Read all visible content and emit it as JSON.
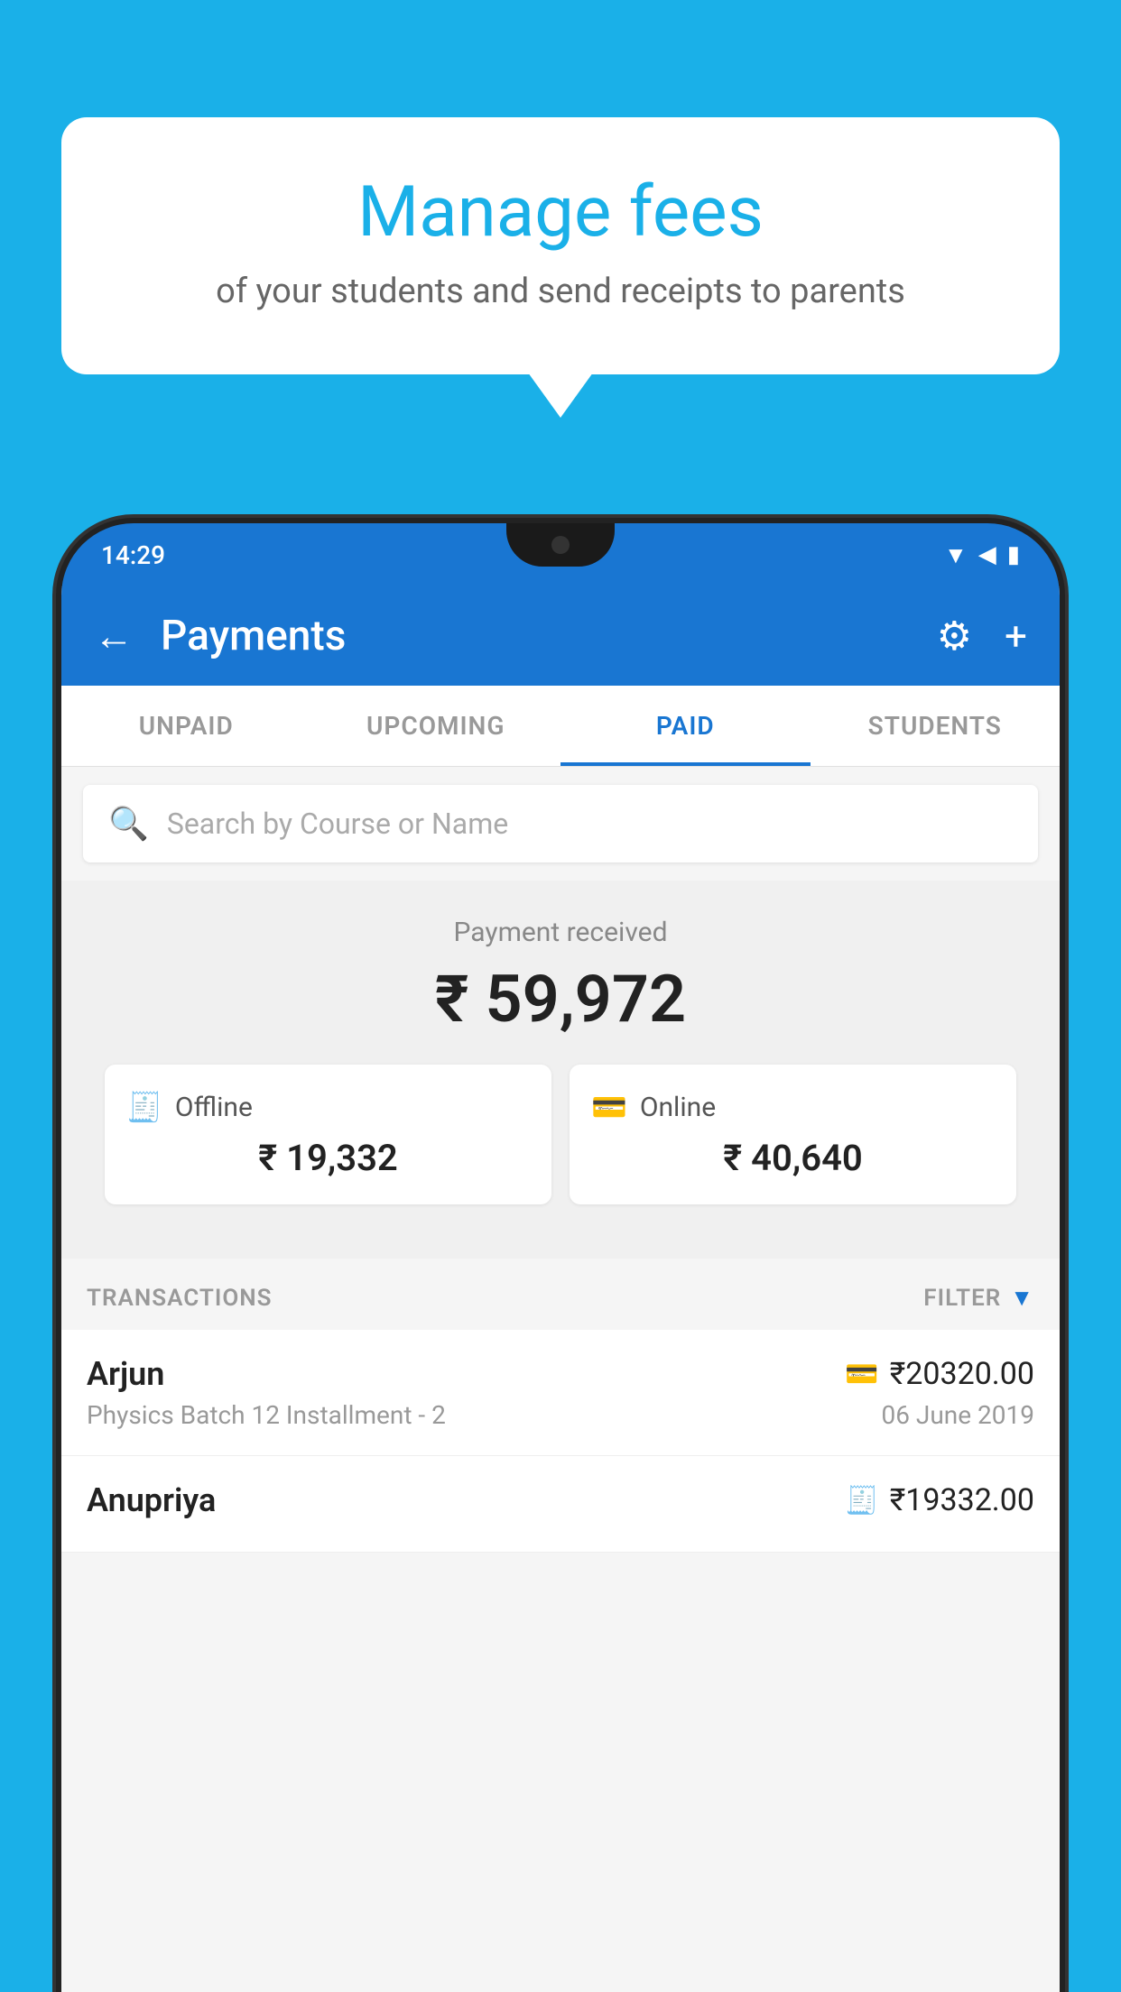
{
  "background_color": "#1ab0e8",
  "bubble": {
    "title": "Manage fees",
    "subtitle": "of your students and send receipts to parents"
  },
  "status_bar": {
    "time": "14:29",
    "wifi": "▲",
    "signal": "◀",
    "battery": "▮"
  },
  "app_bar": {
    "title": "Payments",
    "back_label": "←",
    "gear_label": "⚙",
    "plus_label": "+"
  },
  "tabs": [
    {
      "label": "UNPAID",
      "active": false
    },
    {
      "label": "UPCOMING",
      "active": false
    },
    {
      "label": "PAID",
      "active": true
    },
    {
      "label": "STUDENTS",
      "active": false
    }
  ],
  "search": {
    "placeholder": "Search by Course or Name"
  },
  "payment_summary": {
    "label": "Payment received",
    "total": "₹ 59,972",
    "offline_label": "Offline",
    "offline_amount": "₹ 19,332",
    "online_label": "Online",
    "online_amount": "₹ 40,640"
  },
  "transactions": {
    "header": "TRANSACTIONS",
    "filter_label": "FILTER"
  },
  "transaction_list": [
    {
      "name": "Arjun",
      "course": "Physics Batch 12 Installment - 2",
      "amount": "₹20320.00",
      "date": "06 June 2019",
      "type": "online"
    },
    {
      "name": "Anupriya",
      "course": "",
      "amount": "₹19332.00",
      "date": "",
      "type": "offline"
    }
  ]
}
